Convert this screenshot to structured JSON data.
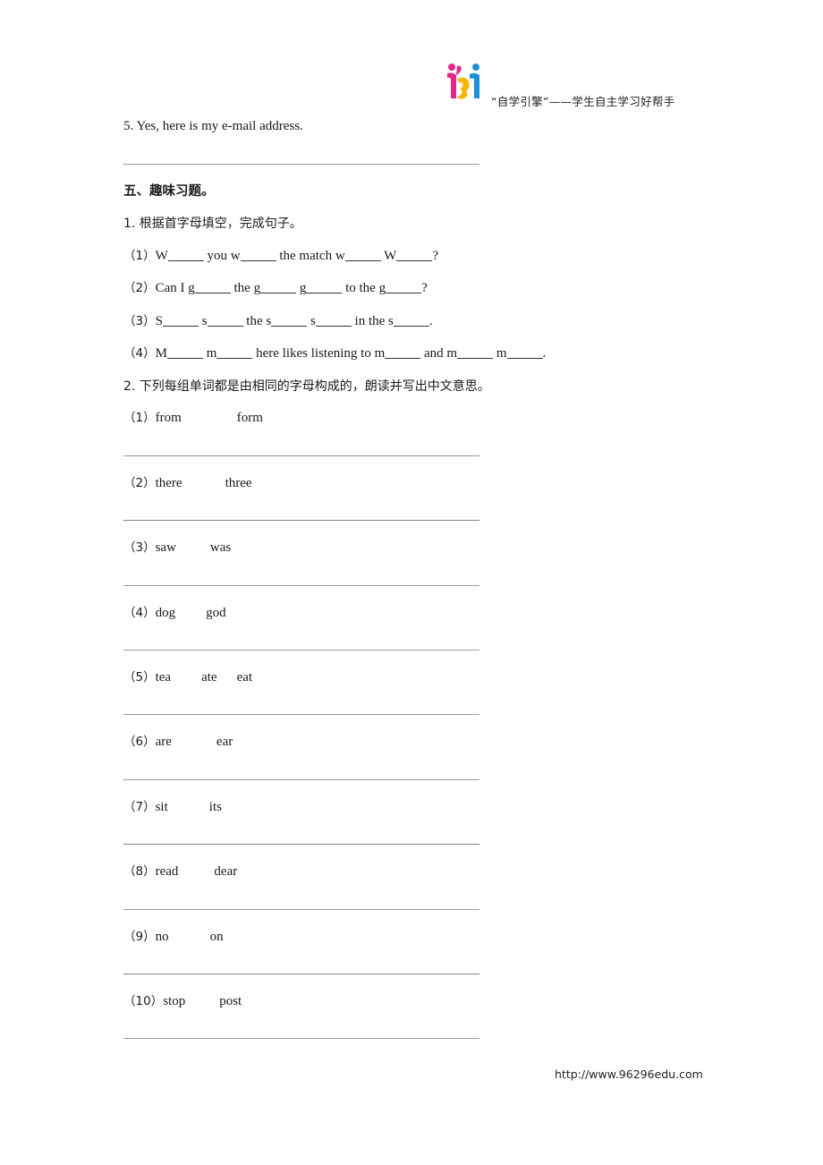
{
  "header": {
    "logo_icon": "zixue-yinqing-logo",
    "tagline": "“自学引擎”——学生自主学习好帮手",
    "logo_colors": {
      "magenta": "#e6268a",
      "yellow": "#f7b500",
      "blue": "#1d8fd8"
    }
  },
  "previous_item": {
    "text": "5. Yes, here is my e-mail address."
  },
  "section_five": {
    "title": "五、趣味习题。",
    "exercise1": {
      "instruction": "1. 根据首字母填空，完成句子。",
      "items": [
        {
          "label": "（1）",
          "segments": [
            "W",
            "_",
            " you w",
            "_",
            " the match w",
            "_",
            " W",
            "_",
            "?"
          ]
        },
        {
          "label": "（2）",
          "segments": [
            "Can I g",
            "_",
            " the g",
            "_",
            " g",
            "_",
            " to the g",
            "_",
            "?"
          ]
        },
        {
          "label": "（3）",
          "segments": [
            "S",
            "_",
            " s",
            "_",
            " the s",
            "_",
            " s",
            "_",
            " in the s",
            "_",
            "."
          ]
        },
        {
          "label": "（4）",
          "segments": [
            "M",
            "_",
            " m",
            "_",
            " here likes listening to m",
            "_",
            " and m",
            "_",
            " m",
            "_",
            "."
          ]
        }
      ]
    },
    "exercise2": {
      "instruction": "2. 下列每组单词都是由相同的字母构成的，朗读并写出中文意思。",
      "items": [
        {
          "label": "（1）",
          "words": [
            "from",
            "form"
          ]
        },
        {
          "label": "（2）",
          "words": [
            "there",
            "three"
          ]
        },
        {
          "label": "（3）",
          "words": [
            "saw",
            "was"
          ]
        },
        {
          "label": "（4）",
          "words": [
            "dog",
            "god"
          ]
        },
        {
          "label": "（5）",
          "words": [
            "tea",
            "ate",
            "eat"
          ]
        },
        {
          "label": "（6）",
          "words": [
            "are",
            "ear"
          ]
        },
        {
          "label": "（7）",
          "words": [
            "sit",
            "its"
          ]
        },
        {
          "label": "（8）",
          "words": [
            "read",
            "dear"
          ]
        },
        {
          "label": "（9）",
          "words": [
            "no",
            "on"
          ]
        },
        {
          "label": "（10）",
          "words": [
            "stop",
            "post"
          ]
        }
      ]
    }
  },
  "footer": {
    "url": "http://www.96296edu.com"
  }
}
